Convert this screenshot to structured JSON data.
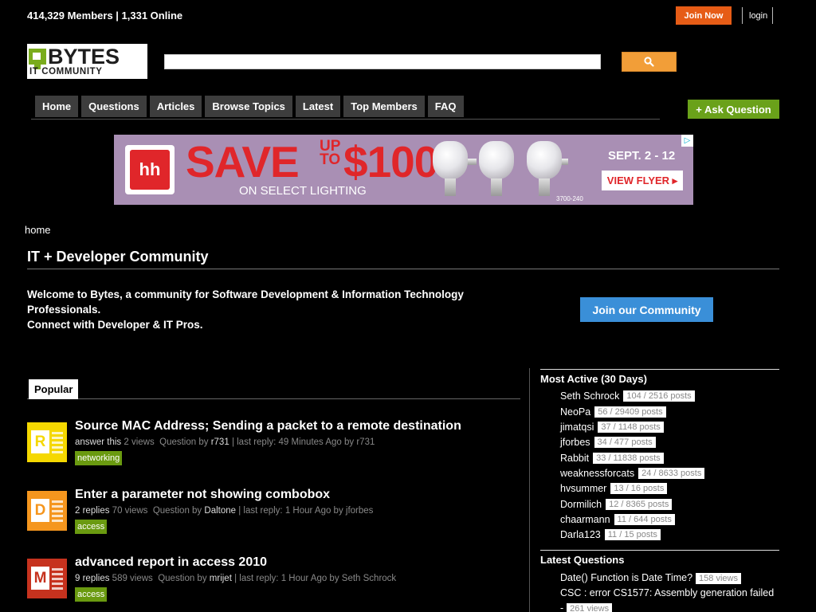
{
  "header": {
    "stats": "414,329 Members | 1,331 Online",
    "join_now": "Join Now",
    "login": "login"
  },
  "logo": {
    "word": "BYTES",
    "sub": "IT COMMUNITY"
  },
  "search": {
    "value": "",
    "placeholder": "",
    "icon": "search-icon"
  },
  "nav": {
    "items": [
      "Home",
      "Questions",
      "Articles",
      "Browse Topics",
      "Latest",
      "Top Members",
      "FAQ"
    ],
    "ask": "+ Ask Question"
  },
  "banner": {
    "save": "SAVE",
    "upto_line1": "UP",
    "upto_line2": "TO",
    "amount": "$100",
    "sub": "ON SELECT LIGHTING",
    "date": "SEPT. 2 - 12",
    "flyer": "VIEW FLYER ▸",
    "code": "3700-240",
    "brand_mark": "hh"
  },
  "breadcrumb": "home",
  "title": "IT + Developer Community",
  "welcome": {
    "line1": "Welcome to Bytes, a community for Software Development & Information Technology Professionals.",
    "line2": "Connect with Developer & IT Pros.",
    "join": "Join our Community"
  },
  "popular": {
    "tab": "Popular",
    "questions": [
      {
        "letter": "R",
        "color": "#f5d800",
        "title": "Source MAC Address; Sending a packet to a remote destination",
        "stat_hl": "answer this",
        "stat_rest": "2 views",
        "by_label": "Question by",
        "author": "r731",
        "last_reply": "| last reply: 49 Minutes Ago by r731",
        "tag": "networking"
      },
      {
        "letter": "D",
        "color": "#f5961e",
        "title": "Enter a parameter not showing combobox",
        "stat_hl": "2 replies",
        "stat_rest": "70 views",
        "by_label": "Question by",
        "author": "Daltone",
        "last_reply": "| last reply: 1 Hour Ago by jforbes",
        "tag": "access"
      },
      {
        "letter": "M",
        "color": "#c6321e",
        "title": "advanced report in access 2010",
        "stat_hl": "9 replies",
        "stat_rest": "589 views",
        "by_label": "Question by",
        "author": "mrijet",
        "last_reply": "| last reply: 1 Hour Ago by Seth Schrock",
        "tag": "access"
      }
    ]
  },
  "most_active": {
    "heading": "Most Active (30 Days)",
    "members": [
      {
        "name": "Seth Schrock",
        "posts": "104 / 2516 posts"
      },
      {
        "name": "NeoPa",
        "posts": "56 / 29409 posts"
      },
      {
        "name": "jimatqsi",
        "posts": "37 / 1148 posts"
      },
      {
        "name": "jforbes",
        "posts": "34 / 477 posts"
      },
      {
        "name": "Rabbit",
        "posts": "33 / 11838 posts"
      },
      {
        "name": "weaknessforcats",
        "posts": "24 / 8633 posts"
      },
      {
        "name": "hvsummer",
        "posts": "13 / 16 posts"
      },
      {
        "name": "Dormilich",
        "posts": "12 / 8365 posts"
      },
      {
        "name": "chaarmann",
        "posts": "11 / 644 posts"
      },
      {
        "name": "Darla123",
        "posts": "11 / 15 posts"
      }
    ]
  },
  "latest_questions": {
    "heading": "Latest Questions",
    "items": [
      {
        "title": "Date() Function is Date Time?",
        "views": "158 views"
      },
      {
        "title": "CSC : error CS1577: Assembly generation failed -",
        "views": "261 views"
      }
    ]
  }
}
